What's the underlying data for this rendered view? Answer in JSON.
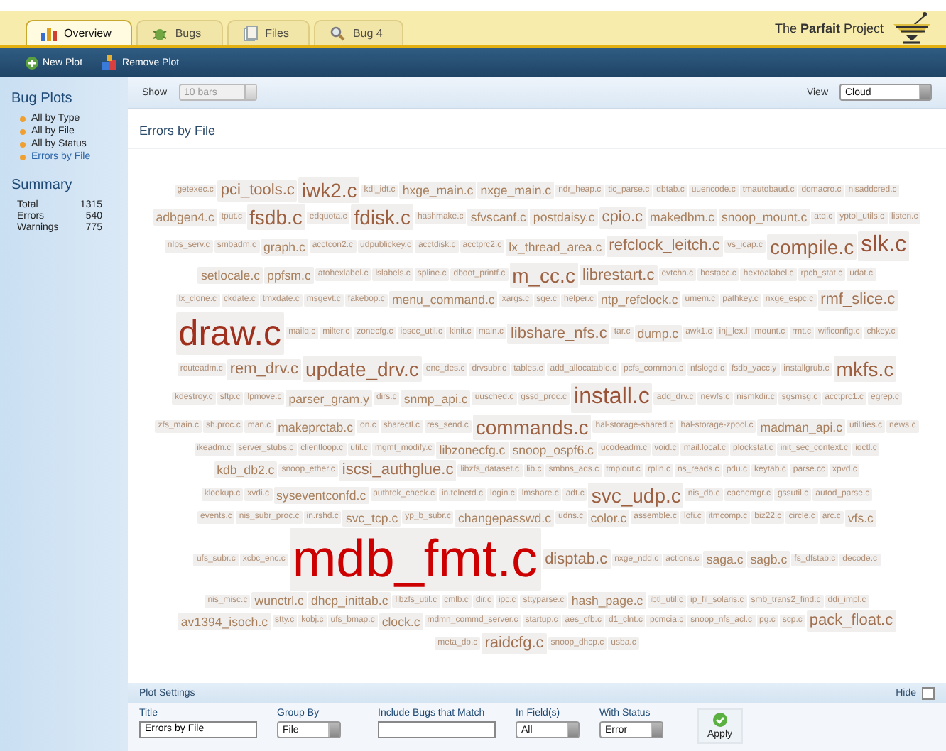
{
  "tabs": [
    {
      "label": "Overview",
      "selected": true
    },
    {
      "label": "Bugs",
      "selected": false
    },
    {
      "label": "Files",
      "selected": false
    },
    {
      "label": "Bug 4",
      "selected": false
    }
  ],
  "logo": "The **Parfait** Project",
  "toolbar": [
    {
      "label": "New Plot"
    },
    {
      "label": "Remove Plot"
    }
  ],
  "sidebar": {
    "title": "Bug Plots",
    "items": [
      {
        "label": "All by Type",
        "selected": false
      },
      {
        "label": "All by File",
        "selected": false
      },
      {
        "label": "All by Status",
        "selected": false
      },
      {
        "label": "Errors by File",
        "selected": true
      }
    ],
    "summary_title": "Summary",
    "summary": [
      {
        "label": "Total",
        "value": "1315"
      },
      {
        "label": "Errors",
        "value": "540"
      },
      {
        "label": "Warnings",
        "value": "775"
      }
    ]
  },
  "show": {
    "label": "Show",
    "value": "10 bars",
    "disabled": true
  },
  "view": {
    "label": "View",
    "value": "Cloud"
  },
  "plot_title": "Errors by File",
  "cloud": {
    "rows": [
      {
        "tags": [
          {
            "name": "getexec.c",
            "kind": "xs"
          },
          {
            "name": "pci_tools.c",
            "kind": "m"
          },
          {
            "name": "iwk2.c",
            "kind": "l"
          },
          {
            "name": "kdi_idt.c",
            "kind": "xs"
          },
          {
            "name": "hxge_main.c",
            "kind": "s"
          },
          {
            "name": "nxge_main.c",
            "kind": "s"
          },
          {
            "name": "ndr_heap.c",
            "kind": "xs"
          },
          {
            "name": "tic_parse.c",
            "kind": "xs"
          },
          {
            "name": "dbtab.c",
            "kind": "xs"
          },
          {
            "name": "uuencode.c",
            "kind": "xs"
          },
          {
            "name": "tmautobaud.c",
            "kind": "xs"
          },
          {
            "name": "domacro.c",
            "kind": "xs"
          },
          {
            "name": "nisaddcred.c",
            "kind": "xs"
          }
        ]
      },
      {
        "tags": [
          {
            "name": "adbgen4.c",
            "kind": "s"
          },
          {
            "name": "tput.c",
            "kind": "xs"
          },
          {
            "name": "fsdb.c",
            "kind": "l"
          },
          {
            "name": "edquota.c",
            "kind": "xs"
          },
          {
            "name": "fdisk.c",
            "kind": "l"
          },
          {
            "name": "hashmake.c",
            "kind": "xs"
          },
          {
            "name": "sfvscanf.c",
            "kind": "s"
          },
          {
            "name": "postdaisy.c",
            "kind": "s"
          },
          {
            "name": "cpio.c",
            "kind": "m"
          },
          {
            "name": "makedbm.c",
            "kind": "s"
          },
          {
            "name": "snoop_mount.c",
            "kind": "s"
          },
          {
            "name": "atq.c",
            "kind": "xs"
          },
          {
            "name": "yptol_utils.c",
            "kind": "xs"
          },
          {
            "name": "listen.c",
            "kind": "xs"
          }
        ]
      },
      {
        "tags": [
          {
            "name": "nlps_serv.c",
            "kind": "xs"
          },
          {
            "name": "smbadm.c",
            "kind": "xs"
          },
          {
            "name": "graph.c",
            "kind": "s"
          },
          {
            "name": "acctcon2.c",
            "kind": "xs"
          },
          {
            "name": "udpublickey.c",
            "kind": "xs"
          },
          {
            "name": "acctdisk.c",
            "kind": "xs"
          },
          {
            "name": "acctprc2.c",
            "kind": "xs"
          },
          {
            "name": "lx_thread_area.c",
            "kind": "s"
          },
          {
            "name": "refclock_leitch.c",
            "kind": "m"
          },
          {
            "name": "vs_icap.c",
            "kind": "xs"
          },
          {
            "name": "compile.c",
            "kind": "l"
          },
          {
            "name": "slk.c",
            "kind": "xl"
          }
        ]
      },
      {
        "tags": [
          {
            "name": "setlocale.c",
            "kind": "s"
          },
          {
            "name": "ppfsm.c",
            "kind": "s"
          },
          {
            "name": "atohexlabel.c",
            "kind": "xs"
          },
          {
            "name": "lslabels.c",
            "kind": "xs"
          },
          {
            "name": "spline.c",
            "kind": "xs"
          },
          {
            "name": "dboot_printf.c",
            "kind": "xs"
          },
          {
            "name": "m_cc.c",
            "kind": "l"
          },
          {
            "name": "librestart.c",
            "kind": "m"
          },
          {
            "name": "evtchn.c",
            "kind": "xs"
          },
          {
            "name": "hostacc.c",
            "kind": "xs"
          },
          {
            "name": "hextoalabel.c",
            "kind": "xs"
          },
          {
            "name": "rpcb_stat.c",
            "kind": "xs"
          },
          {
            "name": "udat.c",
            "kind": "xs"
          }
        ]
      },
      {
        "tags": [
          {
            "name": "lx_clone.c",
            "kind": "xs"
          },
          {
            "name": "ckdate.c",
            "kind": "xs"
          },
          {
            "name": "tmxdate.c",
            "kind": "xs"
          },
          {
            "name": "msgevt.c",
            "kind": "xs"
          },
          {
            "name": "fakebop.c",
            "kind": "xs"
          },
          {
            "name": "menu_command.c",
            "kind": "s"
          },
          {
            "name": "xargs.c",
            "kind": "xs"
          },
          {
            "name": "sge.c",
            "kind": "xs"
          },
          {
            "name": "helper.c",
            "kind": "xs"
          },
          {
            "name": "ntp_refclock.c",
            "kind": "s"
          },
          {
            "name": "umem.c",
            "kind": "xs"
          },
          {
            "name": "pathkey.c",
            "kind": "xs"
          },
          {
            "name": "nxge_espc.c",
            "kind": "xs"
          },
          {
            "name": "rmf_slice.c",
            "kind": "m"
          }
        ]
      },
      {
        "tags": [
          {
            "name": "draw.c",
            "kind": "xxl"
          },
          {
            "name": "mailq.c",
            "kind": "xs"
          },
          {
            "name": "milter.c",
            "kind": "xs"
          },
          {
            "name": "zonecfg.c",
            "kind": "xs"
          },
          {
            "name": "ipsec_util.c",
            "kind": "xs"
          },
          {
            "name": "kinit.c",
            "kind": "xs"
          },
          {
            "name": "main.c",
            "kind": "xs"
          },
          {
            "name": "libshare_nfs.c",
            "kind": "m"
          },
          {
            "name": "tar.c",
            "kind": "xs"
          },
          {
            "name": "dump.c",
            "kind": "s"
          },
          {
            "name": "awk1.c",
            "kind": "xs"
          },
          {
            "name": "inj_lex.l",
            "kind": "xs"
          },
          {
            "name": "mount.c",
            "kind": "xs"
          },
          {
            "name": "rmt.c",
            "kind": "xs"
          },
          {
            "name": "wificonfig.c",
            "kind": "xs"
          },
          {
            "name": "chkey.c",
            "kind": "xs"
          }
        ]
      },
      {
        "tags": [
          {
            "name": "routeadm.c",
            "kind": "xs"
          },
          {
            "name": "rem_drv.c",
            "kind": "m"
          },
          {
            "name": "update_drv.c",
            "kind": "l"
          },
          {
            "name": "enc_des.c",
            "kind": "xs"
          },
          {
            "name": "drvsubr.c",
            "kind": "xs"
          },
          {
            "name": "tables.c",
            "kind": "xs"
          },
          {
            "name": "add_allocatable.c",
            "kind": "xs"
          },
          {
            "name": "pcfs_common.c",
            "kind": "xs"
          },
          {
            "name": "nfslogd.c",
            "kind": "xs"
          },
          {
            "name": "fsdb_yacc.y",
            "kind": "xs"
          },
          {
            "name": "installgrub.c",
            "kind": "xs"
          },
          {
            "name": "mkfs.c",
            "kind": "l"
          }
        ]
      },
      {
        "tags": [
          {
            "name": "kdestroy.c",
            "kind": "xs"
          },
          {
            "name": "sftp.c",
            "kind": "xs"
          },
          {
            "name": "lpmove.c",
            "kind": "xs"
          },
          {
            "name": "parser_gram.y",
            "kind": "s"
          },
          {
            "name": "dirs.c",
            "kind": "xs"
          },
          {
            "name": "snmp_api.c",
            "kind": "s"
          },
          {
            "name": "uusched.c",
            "kind": "xs"
          },
          {
            "name": "gssd_proc.c",
            "kind": "xs"
          },
          {
            "name": "install.c",
            "kind": "xl"
          },
          {
            "name": "add_drv.c",
            "kind": "xs"
          },
          {
            "name": "newfs.c",
            "kind": "xs"
          },
          {
            "name": "nismkdir.c",
            "kind": "xs"
          },
          {
            "name": "sgsmsg.c",
            "kind": "xs"
          },
          {
            "name": "acctprc1.c",
            "kind": "xs"
          },
          {
            "name": "egrep.c",
            "kind": "xs"
          }
        ]
      },
      {
        "tags": [
          {
            "name": "zfs_main.c",
            "kind": "xs"
          },
          {
            "name": "sh.proc.c",
            "kind": "xs"
          },
          {
            "name": "man.c",
            "kind": "xs"
          },
          {
            "name": "makeprctab.c",
            "kind": "s"
          },
          {
            "name": "on.c",
            "kind": "xs"
          },
          {
            "name": "sharectl.c",
            "kind": "xs"
          },
          {
            "name": "res_send.c",
            "kind": "xs"
          },
          {
            "name": "commands.c",
            "kind": "l"
          },
          {
            "name": "hal-storage-shared.c",
            "kind": "xs"
          },
          {
            "name": "hal-storage-zpool.c",
            "kind": "xs"
          },
          {
            "name": "madman_api.c",
            "kind": "s"
          },
          {
            "name": "utilities.c",
            "kind": "xs"
          },
          {
            "name": "news.c",
            "kind": "xs"
          }
        ]
      },
      {
        "tags": [
          {
            "name": "ikeadm.c",
            "kind": "xs"
          },
          {
            "name": "server_stubs.c",
            "kind": "xs"
          },
          {
            "name": "clientloop.c",
            "kind": "xs"
          },
          {
            "name": "util.c",
            "kind": "xs"
          },
          {
            "name": "mgmt_modify.c",
            "kind": "xs"
          },
          {
            "name": "libzonecfg.c",
            "kind": "s"
          },
          {
            "name": "snoop_ospf6.c",
            "kind": "s"
          },
          {
            "name": "ucodeadm.c",
            "kind": "xs"
          },
          {
            "name": "void.c",
            "kind": "xs"
          },
          {
            "name": "mail.local.c",
            "kind": "xs"
          },
          {
            "name": "plockstat.c",
            "kind": "xs"
          },
          {
            "name": "init_sec_context.c",
            "kind": "xs"
          },
          {
            "name": "ioctl.c",
            "kind": "xs"
          }
        ]
      },
      {
        "tags": [
          {
            "name": "kdb_db2.c",
            "kind": "s"
          },
          {
            "name": "snoop_ether.c",
            "kind": "xs"
          },
          {
            "name": "iscsi_authglue.c",
            "kind": "m"
          },
          {
            "name": "libzfs_dataset.c",
            "kind": "xs"
          },
          {
            "name": "lib.c",
            "kind": "xs"
          },
          {
            "name": "smbns_ads.c",
            "kind": "xs"
          },
          {
            "name": "tmplout.c",
            "kind": "xs"
          },
          {
            "name": "rplin.c",
            "kind": "xs"
          },
          {
            "name": "ns_reads.c",
            "kind": "xs"
          },
          {
            "name": "pdu.c",
            "kind": "xs"
          },
          {
            "name": "keytab.c",
            "kind": "xs"
          },
          {
            "name": "parse.cc",
            "kind": "xs"
          },
          {
            "name": "xpvd.c",
            "kind": "xs"
          }
        ]
      },
      {
        "tags": [
          {
            "name": "klookup.c",
            "kind": "xs"
          },
          {
            "name": "xvdi.c",
            "kind": "xs"
          },
          {
            "name": "syseventconfd.c",
            "kind": "s"
          },
          {
            "name": "authtok_check.c",
            "kind": "xs"
          },
          {
            "name": "in.telnetd.c",
            "kind": "xs"
          },
          {
            "name": "login.c",
            "kind": "xs"
          },
          {
            "name": "lmshare.c",
            "kind": "xs"
          },
          {
            "name": "adt.c",
            "kind": "xs"
          },
          {
            "name": "svc_udp.c",
            "kind": "l"
          },
          {
            "name": "nis_db.c",
            "kind": "xs"
          },
          {
            "name": "cachemgr.c",
            "kind": "xs"
          },
          {
            "name": "gssutil.c",
            "kind": "xs"
          },
          {
            "name": "autod_parse.c",
            "kind": "xs"
          }
        ]
      },
      {
        "tags": [
          {
            "name": "events.c",
            "kind": "xs"
          },
          {
            "name": "nis_subr_proc.c",
            "kind": "xs"
          },
          {
            "name": "in.rshd.c",
            "kind": "xs"
          },
          {
            "name": "svc_tcp.c",
            "kind": "s"
          },
          {
            "name": "yp_b_subr.c",
            "kind": "xs"
          },
          {
            "name": "changepasswd.c",
            "kind": "s"
          },
          {
            "name": "udns.c",
            "kind": "xs"
          },
          {
            "name": "color.c",
            "kind": "s"
          },
          {
            "name": "assemble.c",
            "kind": "xs"
          },
          {
            "name": "lofi.c",
            "kind": "xs"
          },
          {
            "name": "itmcomp.c",
            "kind": "xs"
          },
          {
            "name": "biz22.c",
            "kind": "xs"
          },
          {
            "name": "circle.c",
            "kind": "xs"
          },
          {
            "name": "arc.c",
            "kind": "xs"
          },
          {
            "name": "vfs.c",
            "kind": "s"
          }
        ]
      },
      {
        "tags": [
          {
            "name": "ufs_subr.c",
            "kind": "xs"
          },
          {
            "name": "xcbc_enc.c",
            "kind": "xs"
          },
          {
            "name": "mdb_fmt.c",
            "kind": "max"
          },
          {
            "name": "disptab.c",
            "kind": "m"
          },
          {
            "name": "nxge_ndd.c",
            "kind": "xs"
          },
          {
            "name": "actions.c",
            "kind": "xs"
          },
          {
            "name": "saga.c",
            "kind": "s"
          },
          {
            "name": "sagb.c",
            "kind": "s"
          },
          {
            "name": "fs_dfstab.c",
            "kind": "xs"
          },
          {
            "name": "decode.c",
            "kind": "xs"
          }
        ]
      },
      {
        "tags": [
          {
            "name": "nis_misc.c",
            "kind": "xs"
          },
          {
            "name": "wunctrl.c",
            "kind": "s"
          },
          {
            "name": "dhcp_inittab.c",
            "kind": "s"
          },
          {
            "name": "libzfs_util.c",
            "kind": "xs"
          },
          {
            "name": "cmlb.c",
            "kind": "xs"
          },
          {
            "name": "dir.c",
            "kind": "xs"
          },
          {
            "name": "ipc.c",
            "kind": "xs"
          },
          {
            "name": "sttyparse.c",
            "kind": "xs"
          },
          {
            "name": "hash_page.c",
            "kind": "s"
          },
          {
            "name": "ibtl_util.c",
            "kind": "xs"
          },
          {
            "name": "ip_fil_solaris.c",
            "kind": "xs"
          },
          {
            "name": "smb_trans2_find.c",
            "kind": "xs"
          },
          {
            "name": "ddi_impl.c",
            "kind": "xs"
          }
        ]
      },
      {
        "tags": [
          {
            "name": "av1394_isoch.c",
            "kind": "s"
          },
          {
            "name": "stty.c",
            "kind": "xs"
          },
          {
            "name": "kobj.c",
            "kind": "xs"
          },
          {
            "name": "ufs_bmap.c",
            "kind": "xs"
          },
          {
            "name": "clock.c",
            "kind": "s"
          },
          {
            "name": "mdmn_commd_server.c",
            "kind": "xs"
          },
          {
            "name": "startup.c",
            "kind": "xs"
          },
          {
            "name": "aes_cfb.c",
            "kind": "xs"
          },
          {
            "name": "d1_clnt.c",
            "kind": "xs"
          },
          {
            "name": "pcmcia.c",
            "kind": "xs"
          },
          {
            "name": "snoop_nfs_acl.c",
            "kind": "xs"
          },
          {
            "name": "pg.c",
            "kind": "xs"
          },
          {
            "name": "scp.c",
            "kind": "xs"
          },
          {
            "name": "pack_float.c",
            "kind": "m"
          }
        ]
      },
      {
        "tags": [
          {
            "name": "meta_db.c",
            "kind": "xs"
          },
          {
            "name": "raidcfg.c",
            "kind": "m"
          },
          {
            "name": "snoop_dhcp.c",
            "kind": "xs"
          },
          {
            "name": "usba.c",
            "kind": "xs"
          }
        ]
      }
    ]
  },
  "settings": {
    "title": "Plot Settings",
    "hide_label": "Hide",
    "hide_checked": false,
    "fields": [
      {
        "kind": "text",
        "label": "Title",
        "value": "Errors by File"
      },
      {
        "kind": "select",
        "label": "Group By",
        "value": "File"
      },
      {
        "kind": "text",
        "label": "Include Bugs that Match"
      },
      {
        "kind": "select",
        "label": "In Field(s)",
        "value": "All"
      },
      {
        "kind": "select",
        "label": "With Status",
        "value": "Error"
      }
    ],
    "apply": "Apply"
  }
}
